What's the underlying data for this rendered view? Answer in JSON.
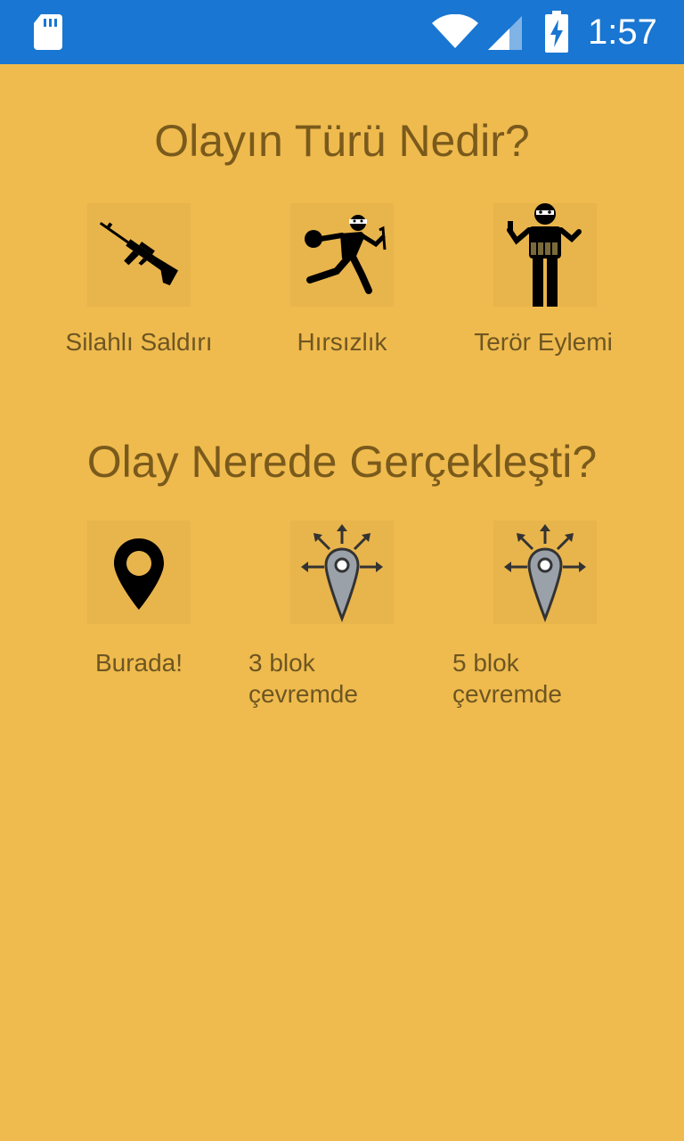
{
  "status_bar": {
    "time": "1:57",
    "icons": [
      "sd-card-icon",
      "wifi-icon",
      "signal-icon",
      "battery-charging-icon"
    ],
    "color": "#1976D2"
  },
  "theme": {
    "background": "#EFBB4E",
    "title_color": "#7A5A1C",
    "label_color": "#6E5622"
  },
  "incident_type": {
    "title": "Olayın Türü Nedir?",
    "options": [
      {
        "label": "Silahlı Saldırı",
        "icon": "rifle-icon"
      },
      {
        "label": "Hırsızlık",
        "icon": "thief-icon"
      },
      {
        "label": "Terör Eylemi",
        "icon": "terrorist-icon"
      }
    ]
  },
  "location": {
    "title": "Olay Nerede Gerçekleşti?",
    "options": [
      {
        "label": "Burada!",
        "icon": "location-pin-icon"
      },
      {
        "label_line1": "3 blok",
        "label_line2": "çevremde",
        "icon": "radius-pin-icon"
      },
      {
        "label_line1": "5 blok",
        "label_line2": "çevremde",
        "icon": "radius-pin-icon"
      }
    ]
  }
}
